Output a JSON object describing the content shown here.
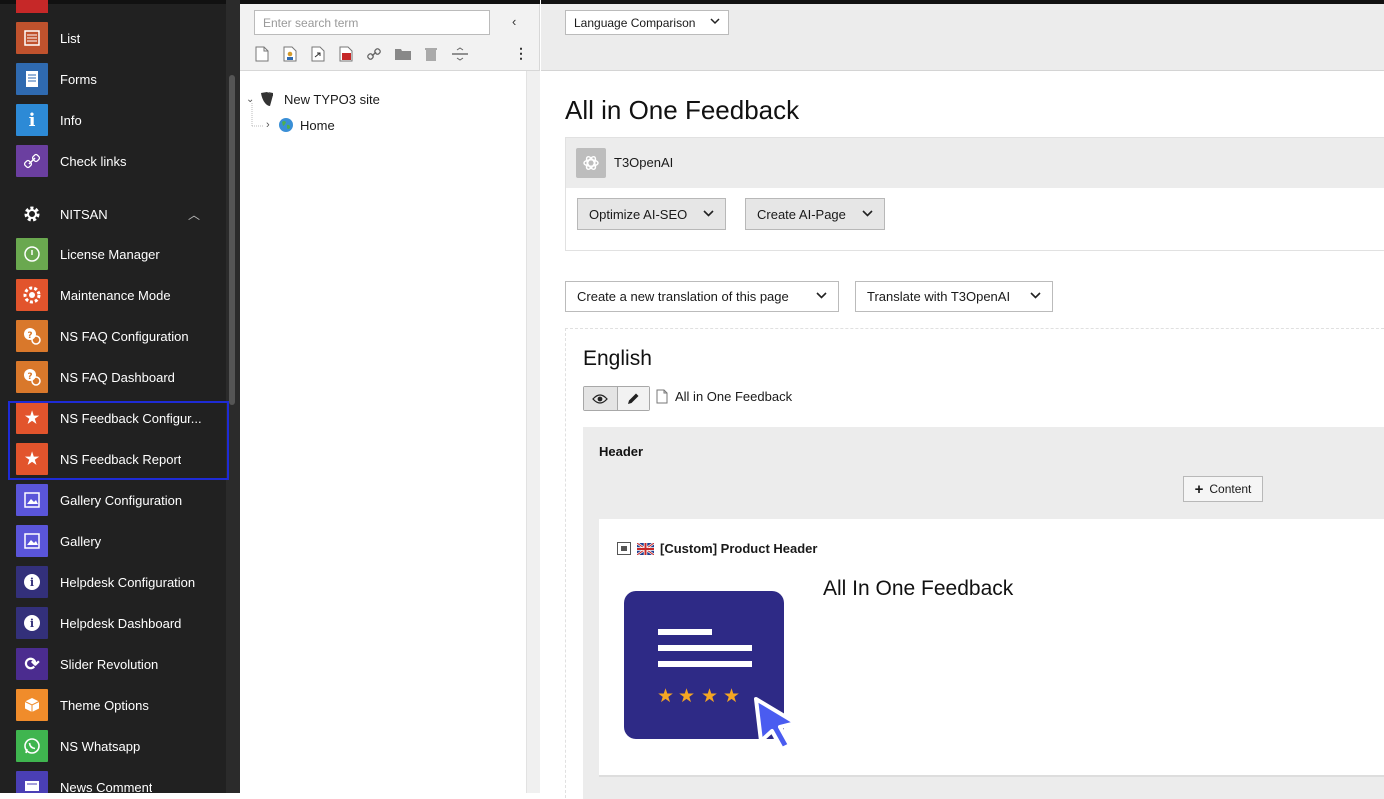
{
  "sidebar": {
    "items": [
      {
        "label": "List",
        "icon": "list-icon",
        "color": "#c0522d"
      },
      {
        "label": "Forms",
        "icon": "forms-icon",
        "color": "#2f6ab0"
      },
      {
        "label": "Info",
        "icon": "info-icon",
        "color": "#2d8ad6"
      },
      {
        "label": "Check links",
        "icon": "link-check-icon",
        "color": "#6b3fa0"
      }
    ],
    "group": {
      "label": "NITSAN",
      "icon": "gear-icon"
    },
    "ext_items": [
      {
        "label": "License Manager",
        "icon": "power-icon",
        "color": "#6aa84f"
      },
      {
        "label": "Maintenance Mode",
        "icon": "maintenance-icon",
        "color": "#e2542c"
      },
      {
        "label": "NS FAQ Configuration",
        "icon": "faq-icon",
        "color": "#d9782b"
      },
      {
        "label": "NS FAQ Dashboard",
        "icon": "faq-icon",
        "color": "#d9782b"
      },
      {
        "label": "NS Feedback Configur...",
        "icon": "star-icon",
        "color": "#e2542c"
      },
      {
        "label": "NS Feedback Report",
        "icon": "star-icon",
        "color": "#e2542c"
      },
      {
        "label": "Gallery Configuration",
        "icon": "gallery-icon",
        "color": "#5a55d9"
      },
      {
        "label": "Gallery",
        "icon": "gallery-icon",
        "color": "#5a55d9"
      },
      {
        "label": "Helpdesk Configuration",
        "icon": "info-circle-icon",
        "color": "#33307a"
      },
      {
        "label": "Helpdesk Dashboard",
        "icon": "info-circle-icon",
        "color": "#33307a"
      },
      {
        "label": "Slider Revolution",
        "icon": "refresh-icon",
        "color": "#4b2c8f"
      },
      {
        "label": "Theme Options",
        "icon": "box-icon",
        "color": "#f08c2b"
      },
      {
        "label": "NS Whatsapp",
        "icon": "whatsapp-icon",
        "color": "#3fb54f"
      },
      {
        "label": "News Comment",
        "icon": "comment-icon",
        "color": "#4a3fb5"
      }
    ]
  },
  "tree": {
    "search_placeholder": "Enter search term",
    "collapse_icon": "chevron-left-icon",
    "root_label": "New TYPO3 site",
    "child_label": "Home"
  },
  "content": {
    "language_dropdown": "Language Comparison",
    "page_title": "All in One Feedback",
    "ai": {
      "name": "T3OpenAI",
      "seo_button": "Optimize AI-SEO",
      "page_button": "Create AI-Page"
    },
    "translation_dropdown": "Create a new translation of this page",
    "translate_with": "Translate with T3OpenAI",
    "language": "English",
    "page_link": "All in One Feedback",
    "colpos_title": "Header",
    "add_content": "Content",
    "element": {
      "type_label": "[Custom] Product Header",
      "heading": "All In One Feedback"
    }
  },
  "colors": {
    "sidebar_bg": "#212121",
    "highlight_border": "#1e2bd6",
    "illustration_bg": "#2e2a86",
    "star": "#f5a623",
    "cursor": "#4a5cf0"
  }
}
